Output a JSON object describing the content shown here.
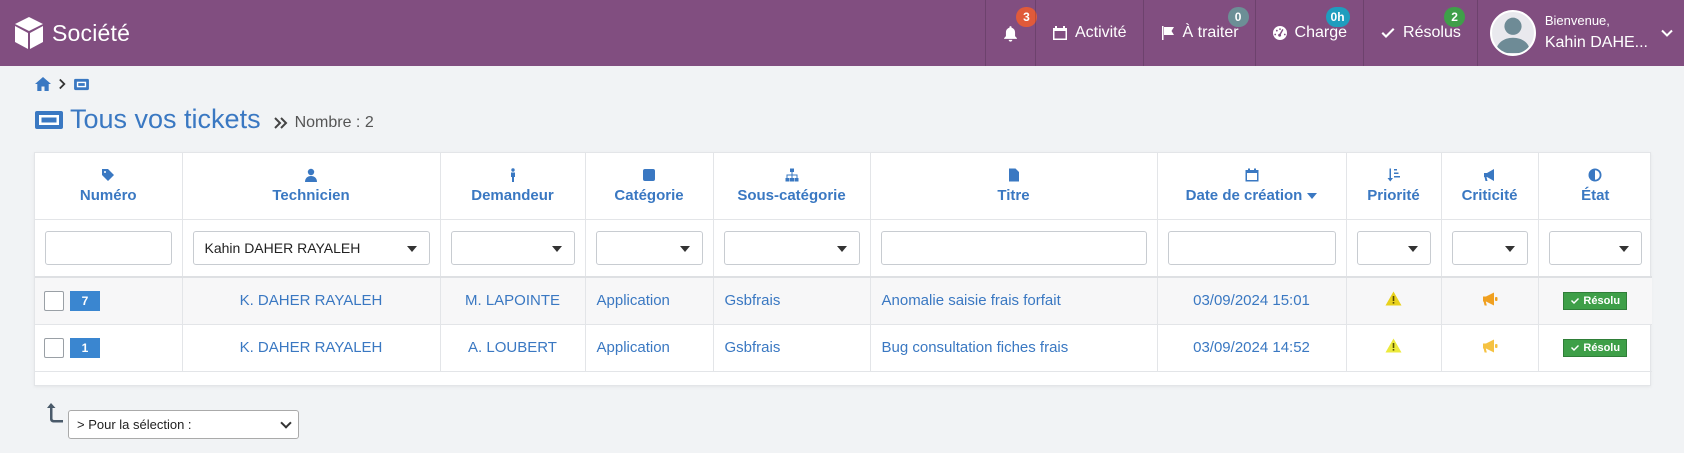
{
  "navbar": {
    "brand": "Société",
    "notifications_count": "3",
    "items": [
      {
        "label": "Activité"
      },
      {
        "label": "À traiter",
        "badge": "0"
      },
      {
        "label": "Charge",
        "badge": "0h"
      },
      {
        "label": "Résolus",
        "badge": "2"
      }
    ],
    "user": {
      "greeting": "Bienvenue,",
      "name": "Kahin DAHE..."
    }
  },
  "page": {
    "title": "Tous vos tickets",
    "count_label": "Nombre : 2"
  },
  "table": {
    "columns": [
      "Numéro",
      "Technicien",
      "Demandeur",
      "Catégorie",
      "Sous-catégorie",
      "Titre",
      "Date de création",
      "Priorité",
      "Criticité",
      "État"
    ],
    "filters": {
      "technicien": "Kahin DAHER RAYALEH"
    },
    "rows": [
      {
        "numero": "7",
        "technicien": "K. DAHER RAYALEH",
        "demandeur": "M. LAPOINTE",
        "categorie": "Application",
        "sous_categorie": "Gsbfrais",
        "titre": "Anomalie saisie frais forfait",
        "date": "03/09/2024 15:01",
        "etat": "Résolu"
      },
      {
        "numero": "1",
        "technicien": "K. DAHER RAYALEH",
        "demandeur": "A. LOUBERT",
        "categorie": "Application",
        "sous_categorie": "Gsbfrais",
        "titre": "Bug consultation fiches frais",
        "date": "03/09/2024 14:52",
        "etat": "Résolu"
      }
    ]
  },
  "bulk_action": {
    "selected": "> Pour la sélection :"
  },
  "colors": {
    "navbar": "#814e80",
    "link": "#3a78c2",
    "resolved": "#3e9f48",
    "priority_warning": "#e8d11c",
    "criticality": "#f0a020"
  }
}
